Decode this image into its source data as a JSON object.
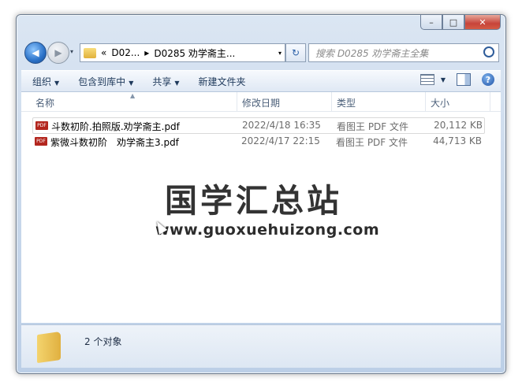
{
  "window": {
    "caption_buttons": {
      "minimize": "–",
      "maximize": "□",
      "close": "✕"
    }
  },
  "navbar": {
    "back_glyph": "◀",
    "forward_glyph": "▶",
    "history_glyph": "▾",
    "address": {
      "overflow": "«",
      "parent": "D02...",
      "sep": "▸",
      "current": "D0285 劝学斋主...",
      "dropdown": "▾"
    },
    "refresh_glyph": "↻",
    "search_placeholder": "搜索 D0285 劝学斋主全集"
  },
  "toolbar": {
    "organize": "组织",
    "include_library": "包含到库中",
    "share": "共享",
    "new_folder": "新建文件夹",
    "dropdown_glyph": "▼",
    "help_glyph": "?"
  },
  "columns": {
    "name": "名称",
    "date": "修改日期",
    "type": "类型",
    "size": "大小",
    "sort_glyph": "▲"
  },
  "files": [
    {
      "name": "斗数初阶.拍照版.劝学斋主.pdf",
      "date": "2022/4/18 16:35",
      "type": "看图王 PDF 文件",
      "size": "20,112 KB"
    },
    {
      "name": "紫微斗数初阶　劝学斋主3.pdf",
      "date": "2022/4/17 22:15",
      "type": "看图王 PDF 文件",
      "size": "44,713 KB"
    }
  ],
  "file_icon_text": "PDF",
  "watermark": {
    "title": "国学汇总站",
    "url": "www.guoxuehuizong.com"
  },
  "status": {
    "count": "2 个对象"
  }
}
